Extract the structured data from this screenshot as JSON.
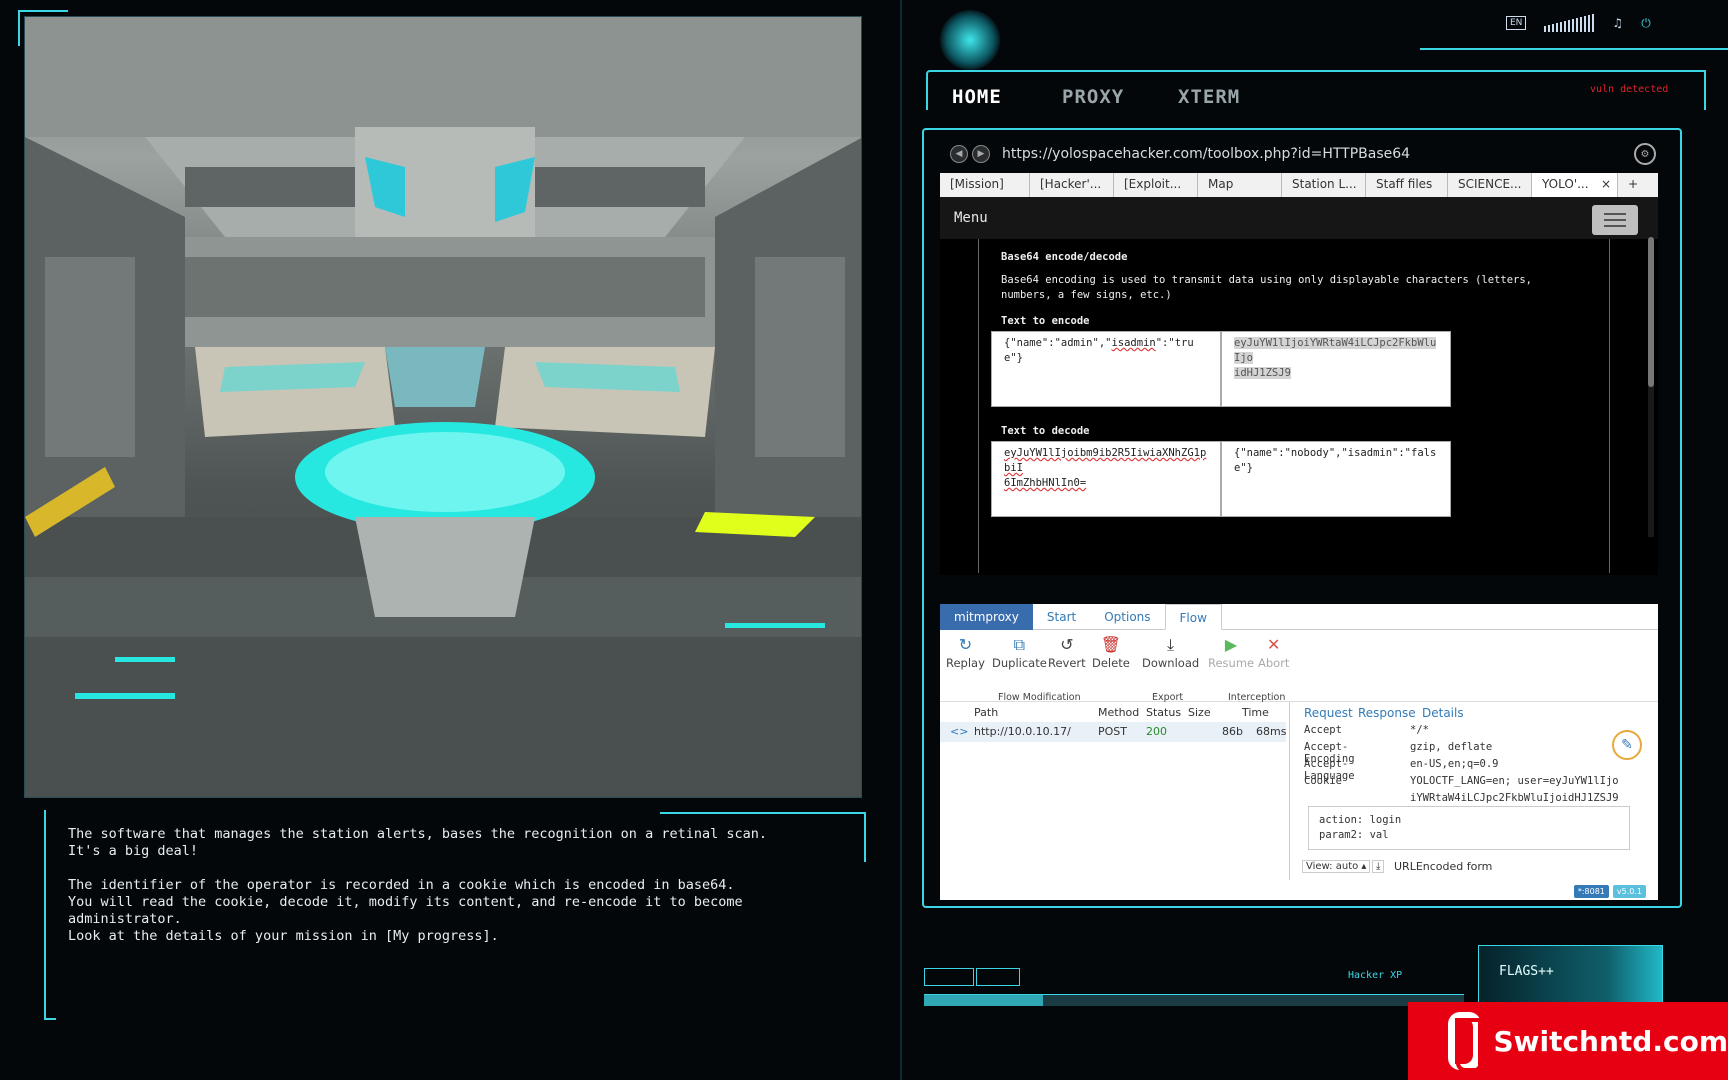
{
  "dialogue": {
    "line1": "The software that manages the station alerts, bases the recognition on a retinal scan.\nIt's a big deal!",
    "line2": "The identifier of the operator is recorded in a cookie which is encoded in base64.\nYou will read the cookie, decode it, modify its content, and re-encode it to become\nadministrator.\nLook at the details of your mission in [My progress]."
  },
  "top_tabs": [
    "HOME",
    "PROXY",
    "XTERM"
  ],
  "vuln_text": "vuln detected",
  "system": {
    "lang": "EN"
  },
  "browser": {
    "url": "https://yolospacehacker.com/toolbox.php?id=HTTPBase64",
    "tabs": [
      "[Mission]",
      "[Hacker'...",
      "[Exploit...",
      "Map",
      "Station L...",
      "Staff files",
      "SCIENCE...",
      "YOLO'...",
      "+"
    ],
    "active_tab_close": "×"
  },
  "page": {
    "menu_label": "Menu",
    "heading": "Base64 encode/decode",
    "description": "Base64 encoding is used to transmit data using only displayable characters (letters,\nnumbers, a few signs, etc.)",
    "encode_label": "Text to encode",
    "encode_input_a": "{\"name\":\"admin\",\"",
    "encode_input_b": "isadmin",
    "encode_input_c": "\":\"true\"}",
    "encode_output": "eyJuYW1lIjoiYWRtaW4iLCJpc2FkbWluIjo\nidHJ1ZSJ9",
    "decode_label": "Text to decode",
    "decode_input": "eyJuYW1lIjoibm9ib2R5IiwiaXNhZG1pbiI\n6ImZhbHNlIn0=",
    "decode_output": "{\"name\":\"nobody\",\"isadmin\":\"false\"}"
  },
  "mitm": {
    "tabs": [
      "mitmproxy",
      "Start",
      "Options",
      "Flow"
    ],
    "buttons": [
      "Replay",
      "Duplicate",
      "Revert",
      "Delete",
      "Download",
      "Resume",
      "Abort"
    ],
    "groups": [
      "Flow Modification",
      "Export",
      "Interception"
    ],
    "columns": [
      "Path",
      "Method",
      "Status",
      "Size",
      "Time"
    ],
    "row": {
      "path": "http://10.0.10.17/",
      "method": "POST",
      "status": "200",
      "size": "86b",
      "time": "68ms"
    },
    "detail_tabs": [
      "Request",
      "Response",
      "Details"
    ],
    "headers": [
      {
        "k": "Accept",
        "v": "*/*"
      },
      {
        "k": "Accept-Encoding",
        "v": "gzip, deflate"
      },
      {
        "k": "Accept-Language",
        "v": "en-US,en;q=0.9"
      },
      {
        "k": "Cookie",
        "v": "YOLOCTF_LANG=en; user=eyJuYW1lIjo"
      },
      {
        "k": "",
        "v": "iYWRtaW4iLCJpc2FkbWluIjoidHJ1ZSJ9"
      }
    ],
    "form": {
      "line1": "action: login",
      "line2": "param2: val"
    },
    "view_label": "View: auto ▴",
    "form_type": "URLEncoded form",
    "badge1": "*:8081",
    "badge2": "v5.0.1"
  },
  "hud": {
    "xp_label": "Hacker XP",
    "flags_label": "FLAGS++"
  },
  "watermark": "Switchntd.com",
  "colors": {
    "accent": "#3bd6e6",
    "alert": "#e0242c",
    "mitm_brand": "#396cad"
  }
}
